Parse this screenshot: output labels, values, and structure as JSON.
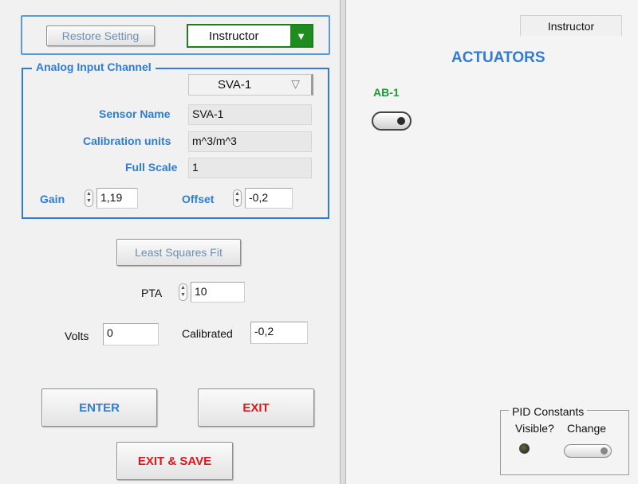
{
  "colors": {
    "accent_blue": "#2f7cd2",
    "ok_green": "#1f8c1f",
    "alert_red": "#e0161b"
  },
  "left_panel": {
    "restore_button": "Restore Setting",
    "profile_select": {
      "value": "Instructor",
      "icon": "dropdown-arrow-icon"
    },
    "analog_input": {
      "title": "Analog Input Channel",
      "channel_select": {
        "value": "SVA-1",
        "icon": "dropdown-triangle-icon"
      },
      "sensor_name": {
        "label": "Sensor Name",
        "value": "SVA-1"
      },
      "calibration_units": {
        "label": "Calibration units",
        "value": "m^3/m^3"
      },
      "full_scale": {
        "label": "Full Scale",
        "value": "1"
      },
      "gain": {
        "label": "Gain",
        "value": "1,19"
      },
      "offset": {
        "label": "Offset",
        "value": "-0,2"
      }
    },
    "least_squares_button": "Least Squares  Fit",
    "pta": {
      "label": "PTA",
      "value": "10"
    },
    "volts": {
      "label": "Volts",
      "value": "0"
    },
    "calibrated": {
      "label": "Calibrated",
      "value": "-0,2"
    },
    "enter_button": "ENTER",
    "exit_button": "EXIT",
    "exit_save_button": "EXIT & SAVE"
  },
  "right_panel": {
    "role_tab": "Instructor",
    "title": "ACTUATORS",
    "actuators": [
      {
        "label": "AB-1",
        "state": "off"
      }
    ],
    "pid_constants": {
      "title": "PID Constants",
      "visible_label": "Visible?",
      "change_label": "Change"
    }
  }
}
